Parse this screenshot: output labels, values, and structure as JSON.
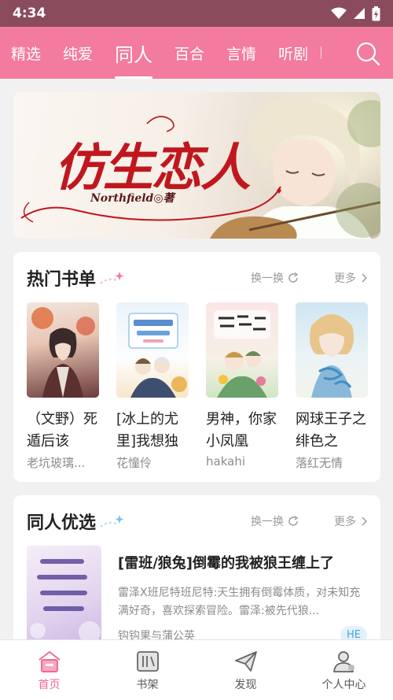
{
  "status_bar": {
    "time": "4:34"
  },
  "nav": {
    "tabs": [
      {
        "label": "精选"
      },
      {
        "label": "纯爱"
      },
      {
        "label": "同人"
      },
      {
        "label": "百合"
      },
      {
        "label": "言情"
      },
      {
        "label": "听剧"
      }
    ],
    "active_tab": "同人"
  },
  "banner": {
    "title": "仿生恋人",
    "author": "Northfield◎著"
  },
  "hot_booklist": {
    "title": "热门书单",
    "refresh_label": "换一换",
    "more_label": "更多",
    "books": [
      {
        "title": "（文野）死遁后该",
        "author": "老坑玻璃..."
      },
      {
        "title": "[冰上的尤里]我想独",
        "author": "花憧伶"
      },
      {
        "title": "男神，你家小凤凰",
        "author": "hakahi"
      },
      {
        "title": "网球王子之绯色之",
        "author": "落红无情"
      }
    ]
  },
  "fanfic_picks": {
    "title": "同人优选",
    "refresh_label": "换一换",
    "more_label": "更多",
    "book": {
      "title": "[雷班/狼兔]倒霉的我被狼王缠上了",
      "description": "雷泽X班尼特班尼特:天生拥有倒霉体质，对未知充满好奇，喜欢探索冒险。雷泽:被先代狼...",
      "author": "钩钩果与蒲公英",
      "tag": "HE"
    }
  },
  "bottom_nav": {
    "items": [
      {
        "label": "首页"
      },
      {
        "label": "书架"
      },
      {
        "label": "发现"
      },
      {
        "label": "个人中心"
      }
    ]
  },
  "colors": {
    "accent": "#f37b9d",
    "status_bar": "#8a4b5c",
    "active_label": "#f06b93"
  }
}
